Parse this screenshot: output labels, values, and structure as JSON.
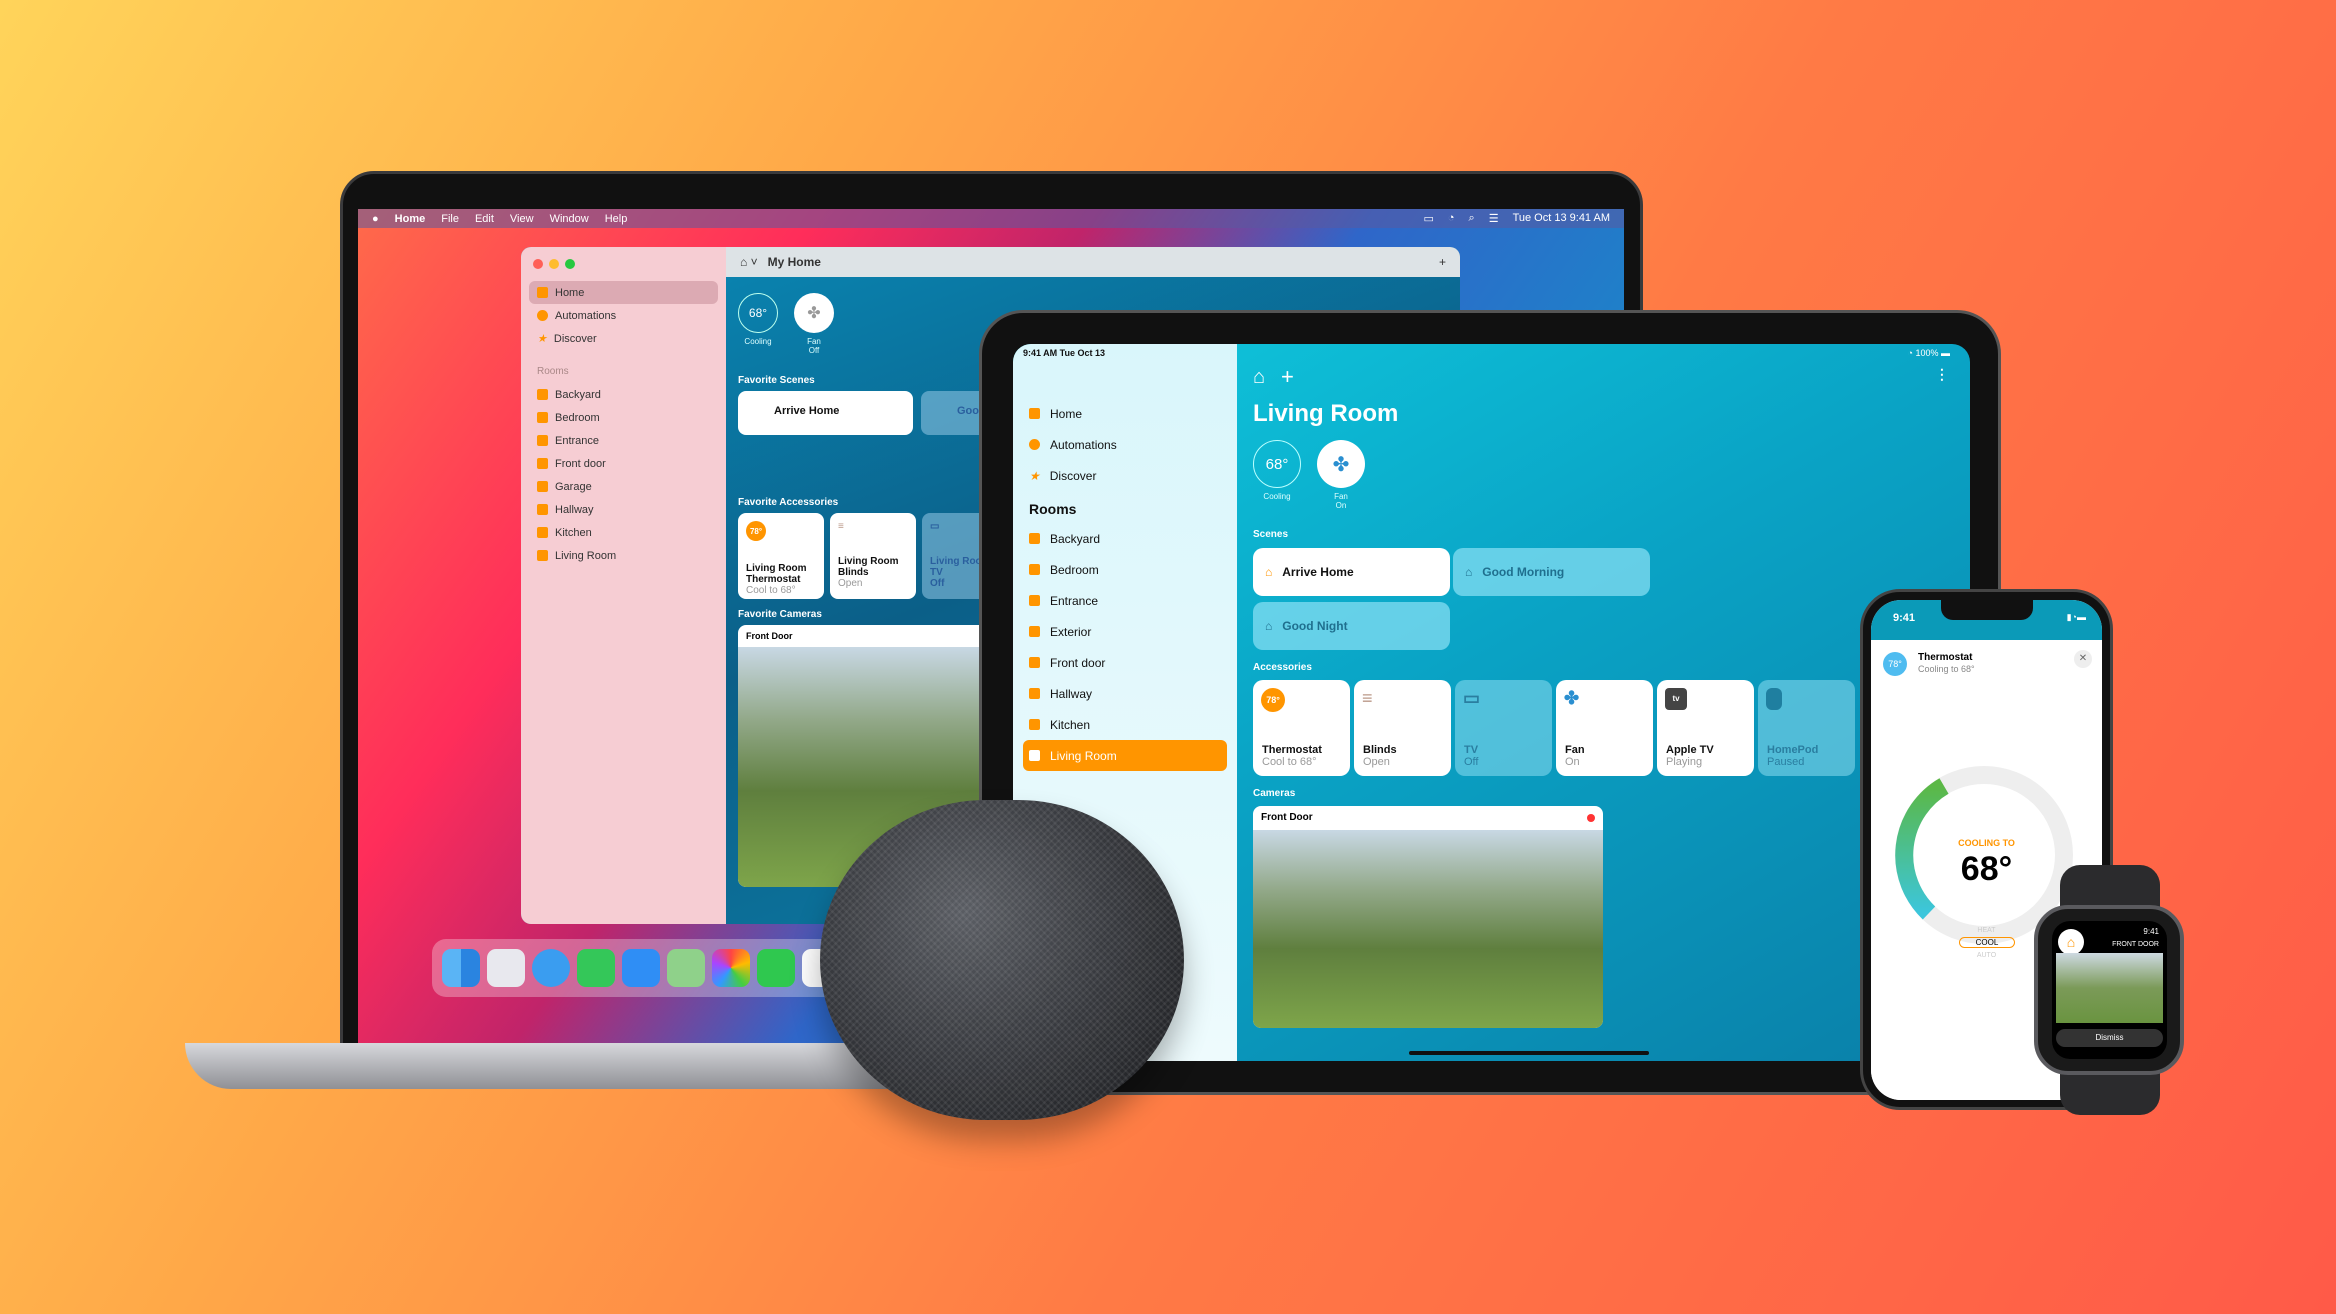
{
  "mac": {
    "menubar": {
      "apple": "",
      "app": "Home",
      "menus": [
        "File",
        "Edit",
        "View",
        "Window",
        "Help"
      ],
      "clock": "Tue Oct 13  9:41 AM"
    },
    "window": {
      "title": "My Home",
      "add": "+",
      "sidebar": {
        "items": [
          "Home",
          "Automations",
          "Discover"
        ],
        "rooms_header": "Rooms",
        "rooms": [
          "Backyard",
          "Bedroom",
          "Entrance",
          "Front door",
          "Garage",
          "Hallway",
          "Kitchen",
          "Living Room"
        ]
      },
      "status": {
        "thermo": "68°",
        "thermo_cap": "Cooling",
        "fan_cap": "Fan",
        "fan_state": "Off"
      },
      "scenes_header": "Favorite Scenes",
      "scenes": [
        "Arrive Home",
        "Good"
      ],
      "accessories_header": "Favorite Accessories",
      "accessories": [
        {
          "name": "Living Room Thermostat",
          "state": "Cool to 68°",
          "badge": "78°"
        },
        {
          "name": "Living Room Blinds",
          "state": "Open"
        },
        {
          "name": "Living Room TV",
          "state": "Off"
        }
      ],
      "cameras_header": "Favorite Cameras",
      "camera": "Front Door"
    }
  },
  "ipad": {
    "status_time": "9:41 AM  Tue Oct 13",
    "battery": "100%",
    "sidebar": {
      "items": [
        "Home",
        "Automations",
        "Discover"
      ],
      "rooms_header": "Rooms",
      "rooms": [
        "Backyard",
        "Bedroom",
        "Entrance",
        "Exterior",
        "Front door",
        "Hallway",
        "Kitchen",
        "Living Room"
      ],
      "selected": "Living Room"
    },
    "title": "Living Room",
    "add": "+",
    "status": {
      "thermo": "68°",
      "thermo_cap": "Cooling",
      "fan_cap": "Fan",
      "fan_state": "On"
    },
    "scenes_header": "Scenes",
    "scenes": [
      "Arrive Home",
      "Good Morning",
      "Good Night"
    ],
    "accessories_header": "Accessories",
    "accessories": [
      {
        "name": "Thermostat",
        "state": "Cool to 68°",
        "badge": "78°"
      },
      {
        "name": "Blinds",
        "state": "Open"
      },
      {
        "name": "TV",
        "state": "Off"
      },
      {
        "name": "Fan",
        "state": "On"
      },
      {
        "name": "Apple TV",
        "state": "Playing",
        "badge": "tv"
      },
      {
        "name": "HomePod",
        "state": "Paused"
      }
    ],
    "cameras_header": "Cameras",
    "camera": "Front Door"
  },
  "iphone": {
    "time": "9:41",
    "card_title": "Thermostat",
    "card_sub": "Cooling to 68°",
    "badge": "78°",
    "close": "✕",
    "mode_label": "COOLING TO",
    "temp": "68°",
    "modes": [
      "HEAT",
      "COOL",
      "AUTO"
    ],
    "selected_mode": "COOL"
  },
  "watch": {
    "time": "9:41",
    "title": "FRONT DOOR",
    "dismiss": "Dismiss"
  },
  "colors": {
    "accent": "#ff9500",
    "teal": "#0aa3c5"
  }
}
